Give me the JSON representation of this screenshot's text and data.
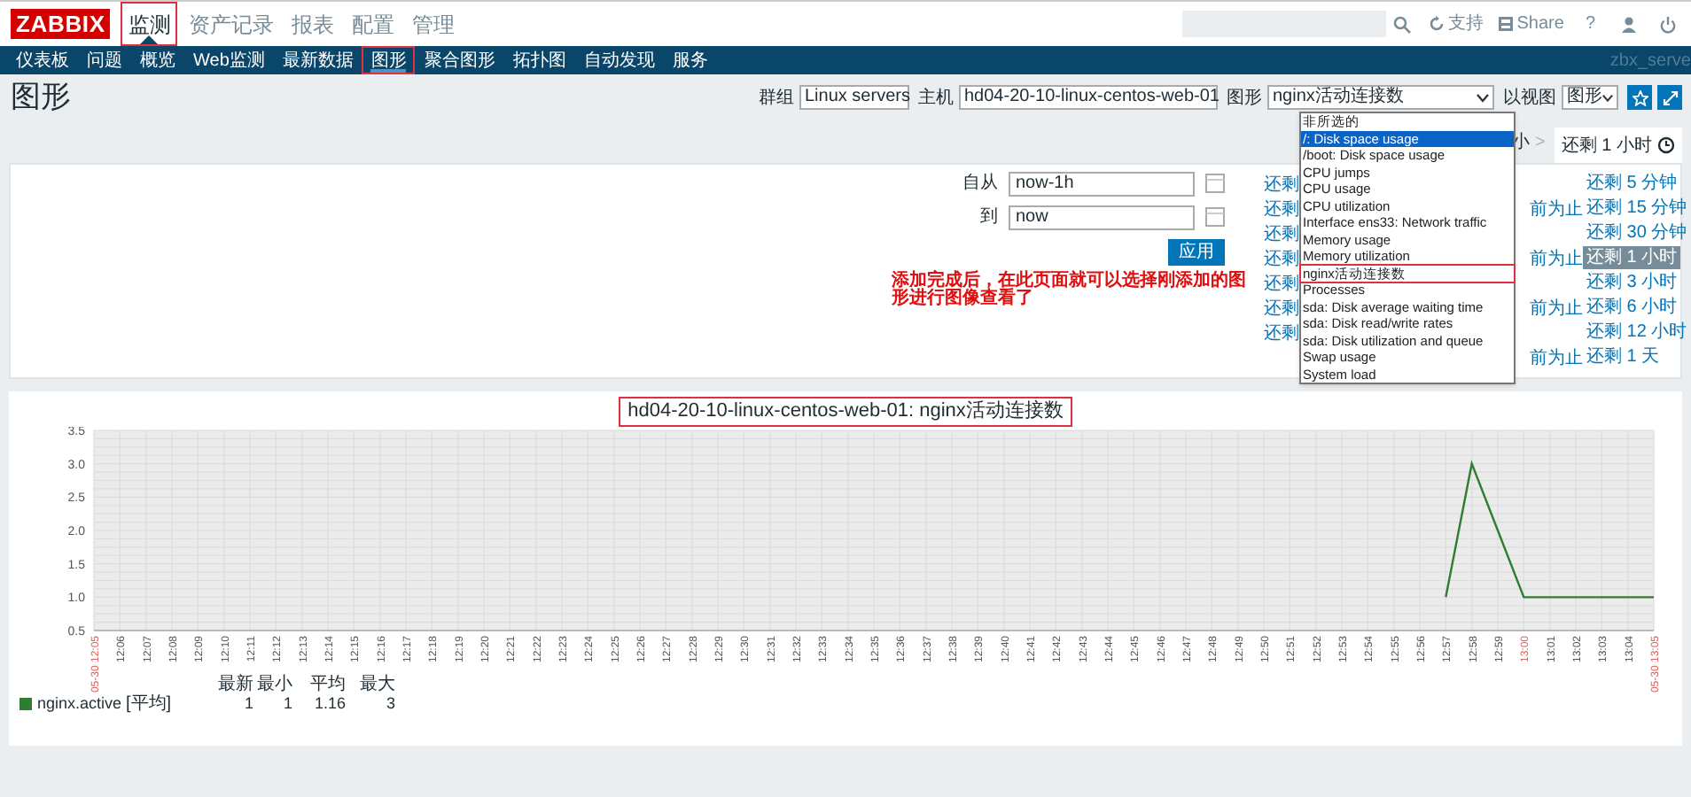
{
  "header": {
    "logo": "ZABBIX",
    "menu": [
      {
        "label": "监测",
        "selected": true,
        "annotated": true
      },
      {
        "label": "资产记录",
        "selected": false,
        "annotated": false
      },
      {
        "label": "报表",
        "selected": false,
        "annotated": false
      },
      {
        "label": "配置",
        "selected": false,
        "annotated": false
      },
      {
        "label": "管理",
        "selected": false,
        "annotated": false
      }
    ],
    "support": "支持",
    "share": "Share",
    "help": "?"
  },
  "subnav": {
    "items": [
      {
        "label": "仪表板",
        "selected": false,
        "annotated": false
      },
      {
        "label": "问题",
        "selected": false,
        "annotated": false
      },
      {
        "label": "概览",
        "selected": false,
        "annotated": false
      },
      {
        "label": "Web监测",
        "selected": false,
        "annotated": false
      },
      {
        "label": "最新数据",
        "selected": false,
        "annotated": false
      },
      {
        "label": "图形",
        "selected": true,
        "annotated": true
      },
      {
        "label": "聚合图形",
        "selected": false,
        "annotated": false
      },
      {
        "label": "拓扑图",
        "selected": false,
        "annotated": false
      },
      {
        "label": "自动发现",
        "selected": false,
        "annotated": false
      },
      {
        "label": "服务",
        "selected": false,
        "annotated": false
      }
    ],
    "server": "zbx_serve"
  },
  "page_title": "图形",
  "filters": [
    {
      "label": "群组",
      "value": "Linux servers"
    },
    {
      "label": "主机",
      "value": "hd04-20-10-linux-centos-web-01"
    },
    {
      "label": "图形",
      "value": "nginx活动连接数"
    },
    {
      "label": "以视图",
      "value": "图形"
    }
  ],
  "graph_dropdown": {
    "options": [
      {
        "label": "非所选的",
        "selected": false,
        "annotated": false
      },
      {
        "label": "/: Disk space usage",
        "selected": true,
        "annotated": false
      },
      {
        "label": "/boot: Disk space usage",
        "selected": false,
        "annotated": false
      },
      {
        "label": "CPU jumps",
        "selected": false,
        "annotated": false
      },
      {
        "label": "CPU usage",
        "selected": false,
        "annotated": false
      },
      {
        "label": "CPU utilization",
        "selected": false,
        "annotated": false
      },
      {
        "label": "Interface ens33: Network traffic",
        "selected": false,
        "annotated": false
      },
      {
        "label": "Memory usage",
        "selected": false,
        "annotated": false
      },
      {
        "label": "Memory utilization",
        "selected": false,
        "annotated": false
      },
      {
        "label": "nginx活动连接数",
        "selected": false,
        "annotated": true
      },
      {
        "label": "Processes",
        "selected": false,
        "annotated": false
      },
      {
        "label": "sda: Disk average waiting time",
        "selected": false,
        "annotated": false
      },
      {
        "label": "sda: Disk read/write rates",
        "selected": false,
        "annotated": false
      },
      {
        "label": "sda: Disk utilization and queue",
        "selected": false,
        "annotated": false
      },
      {
        "label": "Swap usage",
        "selected": false,
        "annotated": false
      },
      {
        "label": "System load",
        "selected": false,
        "annotated": false
      }
    ]
  },
  "time_tabs": {
    "zoom_out_fragment": "小",
    "next": ">",
    "active_tab": "还剩 1 小时"
  },
  "time_filter": {
    "from_label": "自从",
    "from_value": "now-1h",
    "to_label": "到",
    "to_value": "now",
    "apply": "应用"
  },
  "note": "添加完成后，在此页面就可以选择刚添加的图形进行图像查看了",
  "quick_links": {
    "column_1": [
      "还剩",
      "还剩",
      "还剩",
      "还剩",
      "还剩",
      "还剩",
      "还剩"
    ],
    "column_2": [
      "前为止",
      "前为止",
      "前为止",
      "前为止"
    ],
    "column_3": [
      {
        "label": "还剩 5 分钟",
        "selected": false
      },
      {
        "label": "还剩 15 分钟",
        "selected": false
      },
      {
        "label": "还剩 30 分钟",
        "selected": false
      },
      {
        "label": "还剩 1 小时",
        "selected": true
      },
      {
        "label": "还剩 3 小时",
        "selected": false
      },
      {
        "label": "还剩 6 小时",
        "selected": false
      },
      {
        "label": "还剩 12 小时",
        "selected": false
      },
      {
        "label": "还剩 1 天",
        "selected": false
      }
    ]
  },
  "graph": {
    "title": "hd04-20-10-linux-centos-web-01: nginx活动连接数",
    "title_annotated": true,
    "tick_marked": [
      true,
      false,
      false,
      false,
      false,
      false,
      false,
      false,
      false,
      false,
      false,
      false,
      false,
      false,
      false,
      false,
      false,
      false,
      false,
      false,
      false,
      false,
      false,
      false,
      false,
      false,
      false,
      false,
      false,
      false,
      false,
      false,
      false,
      false,
      false,
      false,
      false,
      false,
      false,
      false,
      false,
      false,
      false,
      false,
      false,
      false,
      false,
      false,
      false,
      false,
      false,
      false,
      false,
      false,
      false,
      true,
      false,
      false,
      false,
      false,
      true
    ],
    "chart_data": {
      "type": "line",
      "x": [
        "05-30 12:05",
        "12:06",
        "12:07",
        "12:08",
        "12:09",
        "12:10",
        "12:11",
        "12:12",
        "12:13",
        "12:14",
        "12:15",
        "12:16",
        "12:17",
        "12:18",
        "12:19",
        "12:20",
        "12:21",
        "12:22",
        "12:23",
        "12:24",
        "12:25",
        "12:26",
        "12:27",
        "12:28",
        "12:29",
        "12:30",
        "12:31",
        "12:32",
        "12:33",
        "12:34",
        "12:35",
        "12:36",
        "12:37",
        "12:38",
        "12:39",
        "12:40",
        "12:41",
        "12:42",
        "12:43",
        "12:44",
        "12:45",
        "12:46",
        "12:47",
        "12:48",
        "12:49",
        "12:50",
        "12:51",
        "12:52",
        "12:53",
        "12:54",
        "12:55",
        "12:56",
        "12:57",
        "12:58",
        "12:59",
        "13:00",
        "13:01",
        "13:02",
        "13:03",
        "13:04",
        "05-30 13:05"
      ],
      "series": [
        {
          "name": "nginx.active",
          "color": "#2e7d32",
          "values": [
            null,
            null,
            null,
            null,
            null,
            null,
            null,
            null,
            null,
            null,
            null,
            null,
            null,
            null,
            null,
            null,
            null,
            null,
            null,
            null,
            null,
            null,
            null,
            null,
            null,
            null,
            null,
            null,
            null,
            null,
            null,
            null,
            null,
            null,
            null,
            null,
            null,
            null,
            null,
            null,
            null,
            null,
            null,
            null,
            null,
            null,
            null,
            null,
            null,
            null,
            null,
            null,
            1,
            3,
            2,
            1,
            1,
            1,
            1,
            1,
            1
          ]
        }
      ],
      "ylim": [
        0.5,
        3.5
      ],
      "grid": true,
      "yticks": [
        {
          "value": 0.5,
          "label": "0.5"
        },
        {
          "value": 1,
          "label": "1.0"
        },
        {
          "value": 1.5,
          "label": "1.5"
        },
        {
          "value": 2,
          "label": "2.0"
        },
        {
          "value": 2.5,
          "label": "2.5"
        },
        {
          "value": 3,
          "label": "3.0"
        },
        {
          "value": 3.5,
          "label": "3.5"
        }
      ]
    },
    "legend": {
      "columns": [
        "最新",
        "最小",
        "平均",
        "最大"
      ],
      "items": [
        {
          "func": "[平均]",
          "values": [
            "1",
            "1",
            "1.16",
            "3"
          ]
        }
      ]
    }
  }
}
